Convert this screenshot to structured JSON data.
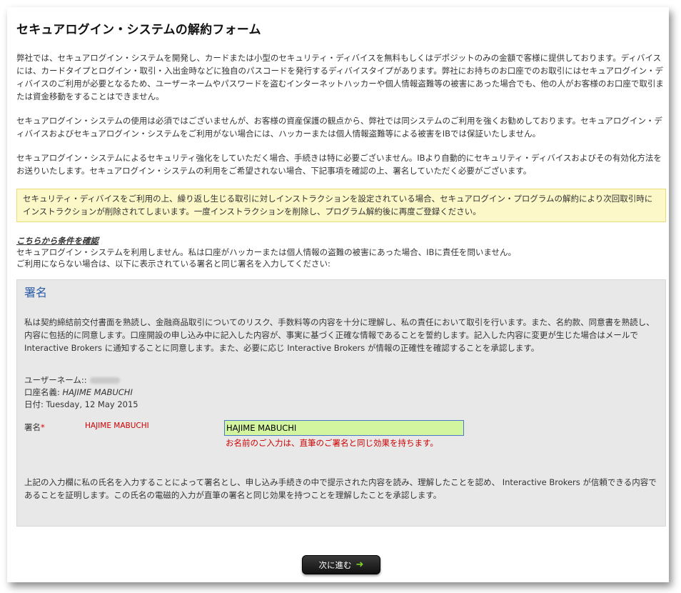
{
  "page": {
    "title": "セキュアログイン・システムの解約フォーム",
    "paragraphs": [
      "弊社では、セキュアログイン・システムを開発し、カードまたは小型のセキュリティ・ディバイスを無料もしくはデポジットのみの金額で客様に提供しております。ディバイスには、カードタイプとログイン・取引・入出金時などに独自のパスコードを発行するディバイスタイプがあります。弊社にお持ちのお口座でのお取引にはセキュアログイン・ディバイスのご利用が必要となるため、ユーザーネームやパスワードを盗むインターネットハッカーや個人情報盗難等の被害にあった場合でも、他の人がお客様のお口座で取引または資金移動をすることはできません。",
      "セキュアログイン・システムの使用は必須ではございませんが、お客様の資産保護の観点から、弊社では同システムのご利用を強くお勧めしております。セキュアログイン・ディバイスおよびセキュアログイン・システムをご利用がない場合には、ハッカーまたは個人情報盗難等による被害をIBでは保証いたしません。",
      "セキュアログイン・システムによるセキュリティ強化をしていただく場合、手続きは特に必要ございません。IBより自動的にセキュリティ・ディバイスおよびその有効化方法をお送りいたします。セキュアログイン・システムの利用をご希望されない場合、下記事項を確認の上、署名していただく必要がございます。"
    ],
    "notice": "セキュリティ・ディバイスをご利用の上、繰り返し生じる取引に対しインストラクションを設定されている場合、セキュアログイン・プログラムの解約により次回取引時にインストラクションが削除されてしまいます。一度インストラクションを削除し、プログラム解約後に再度ご登録ください。",
    "confirm": {
      "heading": "こちらから条件を確認",
      "line1": "セキュアログイン・システムを利用しません。私は口座がハッカーまたは個人情報の盗難の被害にあった場合、IBに責任を問いません。",
      "line2": "ご利用にならない場合は、以下に表示されている署名と同じ署名を入力してください:"
    }
  },
  "signature": {
    "section_title": "署名",
    "agreement": "私は契約締結前交付書面を熟読し、金融商品取引についてのリスク、手数料等の内容を十分に理解し、私の責任において取引を行います。また、名約款、同意書を熟読し、内容に包括的に同意します。口座開設の申し込み中に記入した内容が、事実に基づく正確な情報であることを誓約します。記入した内容に変更が生じた場合はメールで Interactive Brokers に通知することに同意します。また、必要に応じ Interactive Brokers が情報の正確性を確認することを承認します。",
    "username_label": "ユーザーネーム::",
    "account_name_label": "口座名義:",
    "account_name": "HAJIME MABUCHI",
    "date_label": "日付:",
    "date": "Tuesday, 12 May 2015",
    "field_label": "署名",
    "required_mark": "*",
    "expected_signature": "HAJIME MABUCHI",
    "input_value": "HAJIME MABUCHI",
    "field_note": "お名前のご入力は、直筆のご署名と同じ効果を持ちます。",
    "final_statement": "上記の入力欄に私の氏名を入力することによって署名とし、申し込み手続きの中で提示された内容を読み、理解したことを認め、 Interactive Brokers が信頼できる内容であることを証明します。この氏名の電磁的入力が直筆の署名と同じ効果を持つことを理解したことを承認します。"
  },
  "actions": {
    "next_label": "次に進む",
    "next_icon": "arrow-right-icon",
    "accent_color": "#7ed321"
  }
}
